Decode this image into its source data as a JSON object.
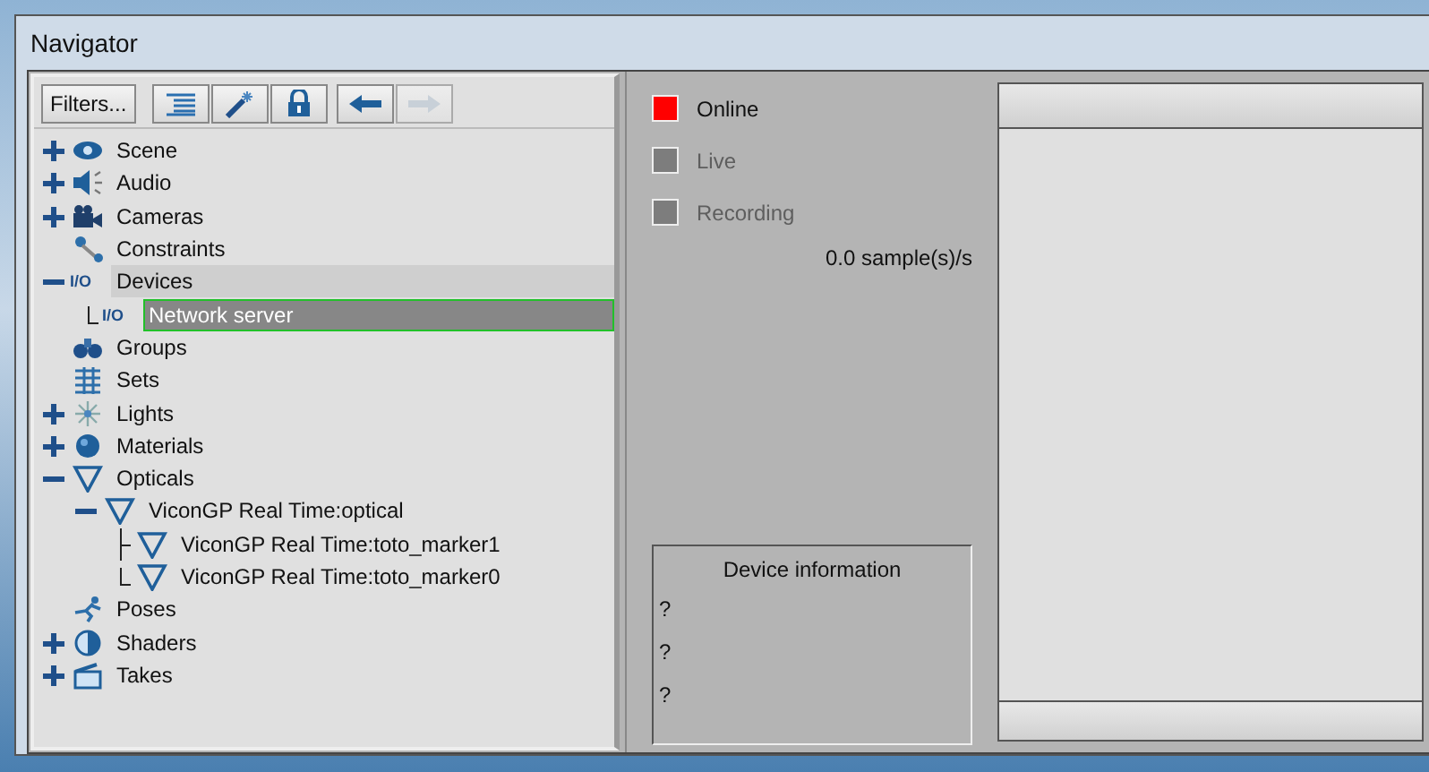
{
  "window": {
    "title": "Navigator"
  },
  "toolbar": {
    "filters": "Filters...",
    "buttons": [
      {
        "kind": "list",
        "disabled": false
      },
      {
        "kind": "wand",
        "disabled": false
      },
      {
        "kind": "lock",
        "disabled": false
      },
      {
        "kind": "back",
        "disabled": false
      },
      {
        "kind": "forward",
        "disabled": true
      }
    ]
  },
  "tree": [
    {
      "label": "Scene",
      "kind": "eye",
      "expanded": false,
      "highlighted": false,
      "selected": false
    },
    {
      "label": "Audio",
      "kind": "speaker",
      "expanded": false,
      "highlighted": false,
      "selected": false
    },
    {
      "label": "Cameras",
      "kind": "camera",
      "expanded": false,
      "highlighted": false,
      "selected": false
    },
    {
      "label": "Constraints",
      "kind": "constraint",
      "highlighted": false,
      "selected": false
    },
    {
      "label": "Devices",
      "tag": "I/O",
      "expanded": true,
      "highlighted": true,
      "selected": false,
      "children": [
        {
          "label": "Network server",
          "tag": "I/O",
          "highlighted": false,
          "selected": true
        }
      ]
    },
    {
      "label": "Groups",
      "kind": "binoculars",
      "highlighted": false,
      "selected": false
    },
    {
      "label": "Sets",
      "kind": "sets",
      "highlighted": false,
      "selected": false
    },
    {
      "label": "Lights",
      "kind": "light",
      "expanded": false,
      "highlighted": false,
      "selected": false
    },
    {
      "label": "Materials",
      "kind": "sphere",
      "expanded": false,
      "highlighted": false,
      "selected": false
    },
    {
      "label": "Opticals",
      "kind": "funnel",
      "expanded": true,
      "highlighted": false,
      "selected": false,
      "children": [
        {
          "label": "ViconGP Real Time:optical",
          "kind": "funnel",
          "expanded": true,
          "highlighted": false,
          "selected": false,
          "children": [
            {
              "label": "ViconGP Real Time:toto_marker1",
              "kind": "funnel",
              "highlighted": false,
              "selected": false
            },
            {
              "label": "ViconGP Real Time:toto_marker0",
              "kind": "funnel",
              "highlighted": false,
              "selected": false
            }
          ]
        }
      ]
    },
    {
      "label": "Poses",
      "kind": "runner",
      "highlighted": false,
      "selected": false
    },
    {
      "label": "Shaders",
      "kind": "shader",
      "expanded": false,
      "highlighted": false,
      "selected": false
    },
    {
      "label": "Takes",
      "kind": "clapper",
      "expanded": false,
      "highlighted": false,
      "selected": false
    }
  ],
  "status": [
    {
      "label": "Online",
      "on": true
    },
    {
      "label": "Live",
      "on": false
    },
    {
      "label": "Recording",
      "on": false
    }
  ],
  "rate": "0.0 sample(s)/s",
  "device_information": {
    "title": "Device information",
    "lines": [
      "?",
      "?",
      "?"
    ]
  }
}
